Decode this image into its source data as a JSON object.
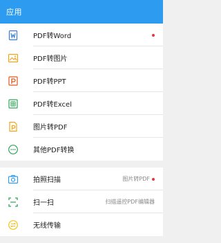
{
  "header": {
    "title": "应用"
  },
  "convert_section": {
    "items": [
      {
        "label": "PDF转Word",
        "icon": "word-doc-icon",
        "color": "#3a7bd5",
        "dot": true
      },
      {
        "label": "PDF转图片",
        "icon": "image-icon",
        "color": "#f2a31a"
      },
      {
        "label": "PDF转PPT",
        "icon": "ppt-icon",
        "color": "#e0571e"
      },
      {
        "label": "PDF转Excel",
        "icon": "excel-icon",
        "color": "#2ea65a"
      },
      {
        "label": "图片转PDF",
        "icon": "pdf-file-icon",
        "color": "#f2a31a"
      },
      {
        "label": "其他PDF转换",
        "icon": "more-icon",
        "color": "#2ea65a"
      }
    ]
  },
  "tools_section": {
    "items": [
      {
        "label": "拍照扫描",
        "icon": "camera-icon",
        "color": "#2d9bef",
        "right": "图片转PDF",
        "dot": true
      },
      {
        "label": "扫一扫",
        "icon": "scan-icon",
        "color": "#2ea65a",
        "right": "扫描遥控PDF编辑器"
      },
      {
        "label": "无线传输",
        "icon": "transfer-icon",
        "color": "#f2c21a"
      }
    ]
  },
  "colors": {
    "accent": "#2d9bef",
    "badge": "#e23a3a"
  }
}
